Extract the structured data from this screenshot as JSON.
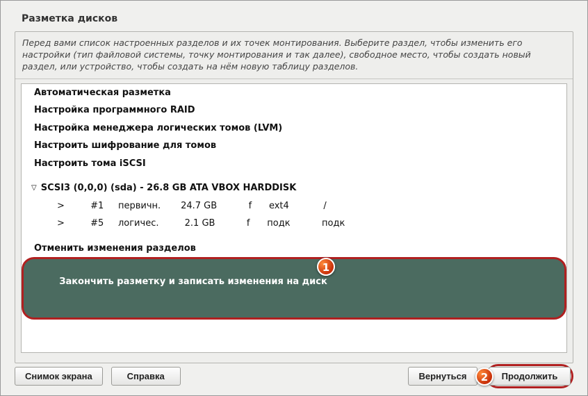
{
  "window": {
    "title": "Разметка дисков"
  },
  "instruction": "Перед вами список настроенных разделов и их точек монтирования. Выберите раздел, чтобы изменить его настройки (тип файловой системы, точку монтирования и так далее), свободное место, чтобы создать новый раздел, или устройство, чтобы создать на нём новую таблицу разделов.",
  "items": {
    "auto": "Автоматическая разметка",
    "raid": "Настройка программного RAID",
    "lvm": "Настройка менеджера логических томов (LVM)",
    "encrypt": "Настроить шифрование для томов",
    "iscsi": "Настроить тома iSCSI",
    "disk": "SCSI3 (0,0,0) (sda) - 26.8 GB ATA VBOX HARDDISK",
    "part1": "        >         #1     первичн.       24.7 GB           f      ext4            /",
    "part5": "        >         #5     логичес.         2.1 GB           f      подк           подк",
    "undo": "Отменить изменения разделов",
    "finish": "Закончить разметку и записать изменения на диск"
  },
  "footer": {
    "screenshot": "Снимок экрана",
    "help": "Справка",
    "back": "Вернуться",
    "continue": "Продолжить"
  },
  "badges": {
    "one": "1",
    "two": "2"
  }
}
